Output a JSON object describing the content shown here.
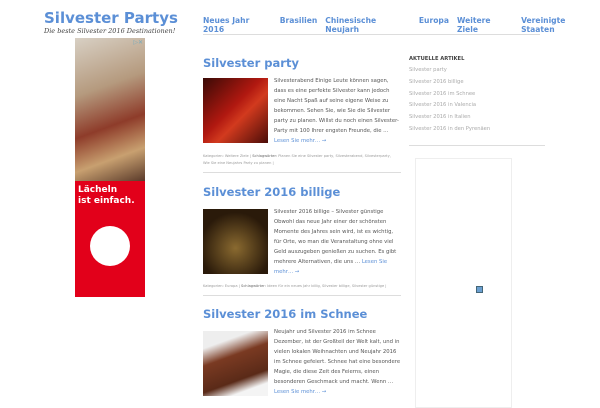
{
  "site": {
    "title": "Silvester Partys",
    "tagline": "Die beste Silvester 2016 Destinationen!"
  },
  "nav": [
    "Neues Jahr 2016",
    "Brasilien",
    "Chinesische Neujarh",
    "Europa",
    "Weitere Ziele",
    "Vereinigte Staaten"
  ],
  "ad_left": {
    "text1": "Lächeln",
    "text2": "ist einfach.",
    "color": "#e2001a"
  },
  "posts": [
    {
      "title": "Silvester party",
      "excerpt": "Silvesterabend Einige Leute können sagen, dass es eine perfekte Silvester kann jedoch eine Nacht Spaß auf seine eigene Weise zu bekommen. Sehen Sie, wie Sie die Silvester party zu planen. Willst du noch einen Silvester-Party mit 100 Ihrer engsten Freunde, die … ",
      "more": "Lesen Sie mehr… →",
      "meta_cat": "Kategorien: Weitere Ziele | ",
      "meta_tags_label": "Schlagwörter:",
      "meta_tags": " Planen Sie eine Silvester party, Silvesterabend, Silvesterparty, Wie Sie eine Neujahrs Party zu planen |"
    },
    {
      "title": "Silvester 2016 billige",
      "excerpt": "Silvester 2016 billige – Silvester günstige Obwohl das neue Jahr einer der schönsten Momente des Jahres sein wird, ist es wichtig, für Orte, wo man die Veranstaltung ohne viel Geld auszugeben genießen zu suchen. Es gibt mehrere Alternativen, die uns … ",
      "more": "Lesen Sie mehr… →",
      "meta_cat": "Kategorien: Europa | ",
      "meta_tags_label": "Schlagwörter:",
      "meta_tags": " Ideen für ein neues Jahr billig, Silvester billige, Silvester günstige |"
    },
    {
      "title": "Silvester 2016 im Schnee",
      "excerpt": "Neujahr und Silvester 2016 im Schnee Dezember, ist der Großteil der Welt kalt, und in vielen lokalen Weihnachten und Neujahr 2016 im Schnee gefeiert. Schnee hat eine besondere Magie, die diese Zeit des Feierns, einen besonderen Geschmack und macht. Wenn … ",
      "more": "Lesen Sie mehr… →"
    }
  ],
  "sidebar": {
    "heading": "AKTUELLE ARTIKEL",
    "items": [
      "Silvester party",
      "Silvester 2016 billige",
      "Silvester 2016 im Schnee",
      "Silvester 2016 in Valencia",
      "Silvester 2016 in Italien",
      "Silvester 2016 in den Pyrenäen"
    ]
  }
}
